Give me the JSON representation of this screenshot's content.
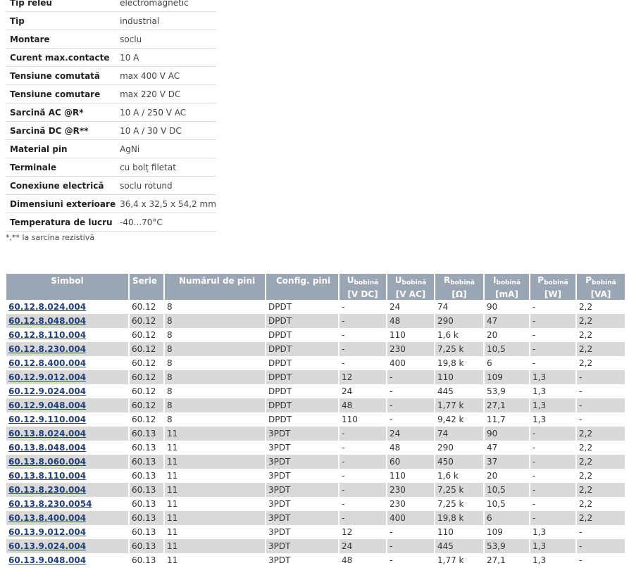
{
  "specs": [
    {
      "label": "Tip releu",
      "value": "electromagnetic"
    },
    {
      "label": "Tip",
      "value": "industrial"
    },
    {
      "label": "Montare",
      "value": "soclu"
    },
    {
      "label": "Curent max.contacte",
      "value": "10 A"
    },
    {
      "label": "Tensiune comutată",
      "value": "max 400 V AC"
    },
    {
      "label": "Tensiune comutare",
      "value": "max 220 V DC"
    },
    {
      "label": "Sarcină AC @R*",
      "value": "10 A / 250 V AC"
    },
    {
      "label": "Sarcină DC @R**",
      "value": "10 A / 30 V DC"
    },
    {
      "label": "Material pin",
      "value": "AgNi"
    },
    {
      "label": "Terminale",
      "value": "cu bolț filetat"
    },
    {
      "label": "Conexiune electrică",
      "value": "soclu rotund"
    },
    {
      "label": "Dimensiuni exterioare",
      "value": "36,4 x 32,5 x 54,2 mm"
    },
    {
      "label": "Temperatura de lucru",
      "value": "-40...70°C"
    }
  ],
  "note": "*,** la sarcina rezistivă",
  "table": {
    "headers": {
      "simbol": "Simbol",
      "serie": "Serie",
      "pini": "Numărul de pini",
      "config": "Config. pini",
      "u_dc_main": "U",
      "u_dc_sub": "bobină",
      "u_dc_unit": "[V DC]",
      "u_ac_main": "U",
      "u_ac_sub": "bobină",
      "u_ac_unit": "[V AC]",
      "r_main": "R",
      "r_sub": "bobină",
      "r_unit": "[Ω]",
      "i_main": "I",
      "i_sub": "bobină",
      "i_unit": "[mA]",
      "p_w_main": "P",
      "p_w_sub": "bobină",
      "p_w_unit": "[W]",
      "p_va_main": "P",
      "p_va_sub": "bobină",
      "p_va_unit": "[VA]"
    },
    "rows": [
      [
        "60.12.8.024.004",
        "60.12",
        "8",
        "DPDT",
        "-",
        "24",
        "74",
        "90",
        "-",
        "2,2"
      ],
      [
        "60.12.8.048.004",
        "60.12",
        "8",
        "DPDT",
        "-",
        "48",
        "290",
        "47",
        "-",
        "2,2"
      ],
      [
        "60.12.8.110.004",
        "60.12",
        "8",
        "DPDT",
        "-",
        "110",
        "1,6 k",
        "20",
        "-",
        "2,2"
      ],
      [
        "60.12.8.230.004",
        "60.12",
        "8",
        "DPDT",
        "-",
        "230",
        "7,25 k",
        "10,5",
        "-",
        "2,2"
      ],
      [
        "60.12.8.400.004",
        "60.12",
        "8",
        "DPDT",
        "-",
        "400",
        "19,8 k",
        "6",
        "-",
        "2,2"
      ],
      [
        "60.12.9.012.004",
        "60.12",
        "8",
        "DPDT",
        "12",
        "-",
        "110",
        "109",
        "1,3",
        "-"
      ],
      [
        "60.12.9.024.004",
        "60.12",
        "8",
        "DPDT",
        "24",
        "-",
        "445",
        "53,9",
        "1,3",
        "-"
      ],
      [
        "60.12.9.048.004",
        "60.12",
        "8",
        "DPDT",
        "48",
        "-",
        "1,77 k",
        "27,1",
        "1,3",
        "-"
      ],
      [
        "60.12.9.110.004",
        "60.12",
        "8",
        "DPDT",
        "110",
        "-",
        "9,42 k",
        "11,7",
        "1,3",
        "-"
      ],
      [
        "60.13.8.024.004",
        "60.13",
        "11",
        "3PDT",
        "-",
        "24",
        "74",
        "90",
        "-",
        "2,2"
      ],
      [
        "60.13.8.048.004",
        "60.13",
        "11",
        "3PDT",
        "-",
        "48",
        "290",
        "47",
        "-",
        "2,2"
      ],
      [
        "60.13.8.060.004",
        "60.13",
        "11",
        "3PDT",
        "-",
        "60",
        "450",
        "37",
        "-",
        "2,2"
      ],
      [
        "60.13.8.110.004",
        "60.13",
        "11",
        "3PDT",
        "-",
        "110",
        "1,6 k",
        "20",
        "-",
        "2,2"
      ],
      [
        "60.13.8.230.004",
        "60.13",
        "11",
        "3PDT",
        "-",
        "230",
        "7,25 k",
        "10,5",
        "-",
        "2,2"
      ],
      [
        "60.13.8.230.0054",
        "60.13",
        "11",
        "3PDT",
        "-",
        "230",
        "7,25 k",
        "10,5",
        "-",
        "2,2"
      ],
      [
        "60.13.8.400.004",
        "60.13",
        "11",
        "3PDT",
        "-",
        "400",
        "19,8 k",
        "6",
        "-",
        "2,2"
      ],
      [
        "60.13.9.012.004",
        "60.13",
        "11",
        "3PDT",
        "12",
        "-",
        "110",
        "109",
        "1,3",
        "-"
      ],
      [
        "60.13.9.024.004",
        "60.13",
        "11",
        "3PDT",
        "24",
        "-",
        "445",
        "53,9",
        "1,3",
        "-"
      ],
      [
        "60.13.9.048.004",
        "60.13",
        "11",
        "3PDT",
        "48",
        "-",
        "1,77 k",
        "27,1",
        "1,3",
        "-"
      ]
    ]
  }
}
